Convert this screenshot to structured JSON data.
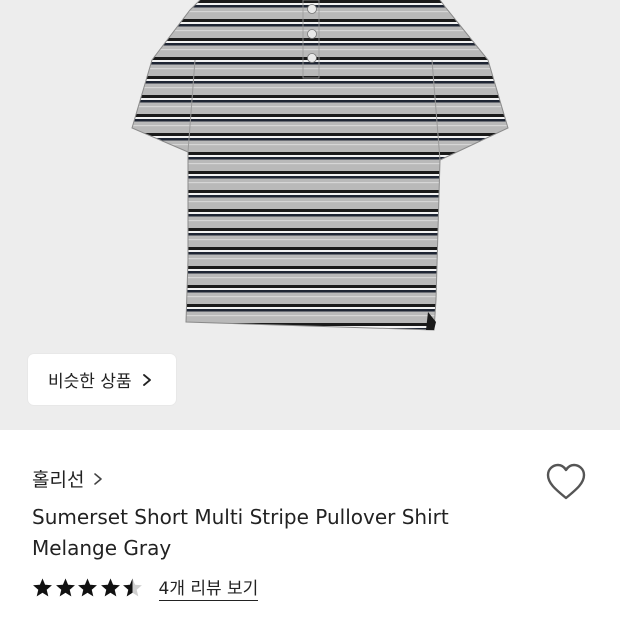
{
  "product_image": {
    "icon": "striped-polo-shirt-image",
    "background": "#ededed"
  },
  "similar_products": {
    "label": "비슷한 상품",
    "icon": "chevron-right-icon"
  },
  "brand": {
    "name": "홀리선",
    "icon": "chevron-right-icon"
  },
  "wishlist": {
    "icon": "heart-outline-icon"
  },
  "product": {
    "title_line1": "Sumerset Short Multi Stripe Pullover Shirt",
    "title_line2": "Melange Gray"
  },
  "rating": {
    "value": 4.5,
    "max": 5,
    "review_link": "4개 리뷰 보기"
  }
}
